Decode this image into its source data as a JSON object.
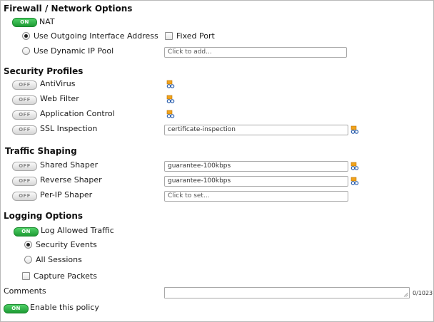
{
  "firewall": {
    "heading": "Firewall / Network Options",
    "nat": {
      "toggle": "ON",
      "label": "NAT"
    },
    "use_outgoing": "Use Outgoing Interface Address",
    "fixed_port": "Fixed Port",
    "use_dynamic": "Use Dynamic IP Pool",
    "pool_placeholder": "Click to add..."
  },
  "security": {
    "heading": "Security Profiles",
    "items": [
      {
        "toggle": "OFF",
        "label": "AntiVirus"
      },
      {
        "toggle": "OFF",
        "label": "Web Filter"
      },
      {
        "toggle": "OFF",
        "label": "Application Control"
      },
      {
        "toggle": "OFF",
        "label": "SSL Inspection"
      }
    ],
    "ssl_value": "certificate-inspection"
  },
  "shaping": {
    "heading": "Traffic Shaping",
    "items": [
      {
        "toggle": "OFF",
        "label": "Shared Shaper"
      },
      {
        "toggle": "OFF",
        "label": "Reverse Shaper"
      },
      {
        "toggle": "OFF",
        "label": "Per-IP Shaper"
      }
    ],
    "shared_value": "guarantee-100kbps",
    "reverse_value": "guarantee-100kbps",
    "perip_placeholder": "Click to set..."
  },
  "logging": {
    "heading": "Logging Options",
    "log_allowed": {
      "toggle": "ON",
      "label": "Log Allowed Traffic"
    },
    "security_events": "Security Events",
    "all_sessions": "All Sessions",
    "capture_packets": "Capture Packets"
  },
  "comments": {
    "label": "Comments",
    "counter": "0/1023"
  },
  "enable": {
    "toggle": "ON",
    "label": "Enable this policy"
  },
  "colors": {
    "toggle_on": "#1e9b34",
    "icon_blue": "#2b5fae",
    "icon_orange": "#f2a31b"
  }
}
